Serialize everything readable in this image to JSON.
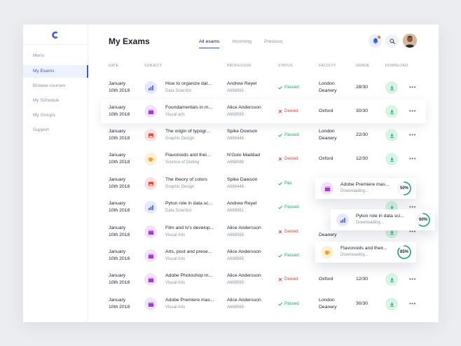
{
  "sidebar": {
    "menu_label": "Menu",
    "items": [
      {
        "label": "My Exams",
        "active": true
      },
      {
        "label": "Browse courses",
        "active": false
      },
      {
        "label": "My Schedule",
        "active": false
      },
      {
        "label": "My Groups",
        "active": false
      },
      {
        "label": "Support",
        "active": false
      }
    ]
  },
  "header": {
    "title": "My Exams",
    "tabs": [
      {
        "label": "All exams",
        "active": true
      },
      {
        "label": "Incoming",
        "active": false
      },
      {
        "label": "Previous",
        "active": false
      }
    ],
    "icons": {
      "notification": "bell-icon",
      "search": "search-icon",
      "avatar": "user-avatar"
    }
  },
  "columns": [
    "Date",
    "Subject",
    "Professor",
    "Status",
    "Faculty",
    "Grade",
    "Download"
  ],
  "colors": {
    "accent": "#3a57e8",
    "passed": "#1aa86f",
    "denied": "#e8423b",
    "download_bg": "#d7f5e6",
    "notification_dot": "#f07b1a"
  },
  "rows": [
    {
      "date1": "January",
      "date2": "10th 2018",
      "subject": "How to organize dat...",
      "category": "Data Scientist",
      "icon": "bar-chart-icon",
      "professor": "Andrew Reyel",
      "prof_id": "A668991",
      "status": "Passed",
      "faculty1": "London",
      "faculty2": "Deanery",
      "grade": "28/30"
    },
    {
      "date1": "January",
      "date2": "10th 2018",
      "subject": "Foundamentals in m...",
      "category": "Visual arts",
      "icon": "clapperboard-icon",
      "professor": "Alice Andersson",
      "prof_id": "A668565",
      "status": "Denied",
      "faculty1": "Oxford",
      "faculty2": "",
      "grade": "30/30",
      "highlighted": true
    },
    {
      "date1": "January",
      "date2": "10th 2018",
      "subject": "The origin of typogr...",
      "category": "Graphic Design",
      "icon": "image-icon",
      "professor": "Spike Dowson",
      "prof_id": "A668446",
      "status": "Passed",
      "faculty1": "London",
      "faculty2": "Deanery",
      "grade": "22/30"
    },
    {
      "date1": "January",
      "date2": "10th 2018",
      "subject": "Flavonoids and thei...",
      "category": "Science of Dieting",
      "icon": "cup-icon",
      "professor": "N'Golo Maddad",
      "prof_id": "A668088",
      "status": "Denied",
      "faculty1": "Oxford",
      "faculty2": "",
      "grade": "12/30"
    },
    {
      "date1": "January",
      "date2": "10th 2018",
      "subject": "The theory of colors",
      "category": "Graphic Design",
      "icon": "image-icon",
      "professor": "Spike Dawson",
      "prof_id": "A668446",
      "status": "Pas",
      "faculty1": "",
      "faculty2": "",
      "grade": ""
    },
    {
      "date1": "January",
      "date2": "10th 2018",
      "subject": "Pyton role in data sc...",
      "category": "Data Scientist",
      "icon": "bar-chart-icon",
      "professor": "Andrew Reyel",
      "prof_id": "A668991",
      "status": "Passed",
      "faculty1": "",
      "faculty2": "",
      "grade": ""
    },
    {
      "date1": "January",
      "date2": "10th 2018",
      "subject": "Film and tv's develop...",
      "category": "Visual Arts",
      "icon": "clapperboard-icon",
      "professor": "Alice Andersson",
      "prof_id": "A668565",
      "status": "Denied",
      "faculty1": "",
      "faculty2": "Deanery",
      "grade": ""
    },
    {
      "date1": "January",
      "date2": "10th 2018",
      "subject": "Arts, post and prese...",
      "category": "Visual Arts",
      "icon": "clapperboard-icon",
      "professor": "Alice Andersson",
      "prof_id": "A668565",
      "status": "Passed",
      "faculty1": "",
      "faculty2": "",
      "grade": ""
    },
    {
      "date1": "January",
      "date2": "10th 2018",
      "subject": "Adobe Photoshop m...",
      "category": "Visual Arts",
      "icon": "clapperboard-icon",
      "professor": "Alice Andersson",
      "prof_id": "A668565",
      "status": "Denied",
      "faculty1": "Oxford",
      "faculty2": "",
      "grade": "12/30"
    },
    {
      "date1": "January",
      "date2": "10th 2018",
      "subject": "Adobe Premiere mas...",
      "category": "Visual Arts",
      "icon": "clapperboard-icon",
      "professor": "Alice Andersson",
      "prof_id": "A668565",
      "status": "Passed",
      "faculty1": "London",
      "faculty2": "Deanery",
      "grade": "30/30"
    }
  ],
  "downloads": [
    {
      "title": "Adobe Premiere mas...",
      "status": "Downloading...",
      "progress": 50,
      "progress_label": "50%",
      "icon": "clapperboard-icon"
    },
    {
      "title": "Pyton role in data sci...",
      "status": "Downloading...",
      "progress": 60,
      "progress_label": "60%",
      "icon": "bar-chart-icon"
    },
    {
      "title": "Flavonoids and their...",
      "status": "Downloading...",
      "progress": 85,
      "progress_label": "85%",
      "icon": "cup-icon"
    }
  ]
}
